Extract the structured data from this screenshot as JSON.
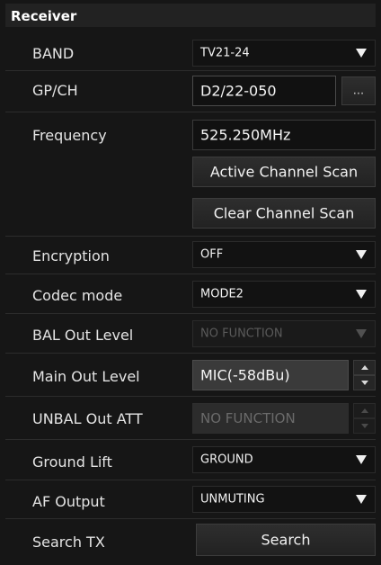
{
  "header": {
    "title": "Receiver"
  },
  "band": {
    "label": "BAND",
    "value": "TV21-24"
  },
  "gpch": {
    "label": "GP/CH",
    "value": "D2/22-050",
    "more_label": "..."
  },
  "frequency": {
    "label": "Frequency",
    "value": "525.250MHz"
  },
  "active_scan": {
    "label": "Active Channel Scan"
  },
  "clear_scan": {
    "label": "Clear Channel Scan"
  },
  "encryption": {
    "label": "Encryption",
    "value": "OFF"
  },
  "codec": {
    "label": "Codec mode",
    "value": "MODE2"
  },
  "bal_out": {
    "label": "BAL Out Level",
    "value": "NO FUNCTION"
  },
  "main_out": {
    "label": "Main Out Level",
    "value": "MIC(-58dBu)"
  },
  "unbal_att": {
    "label": "UNBAL Out ATT",
    "value": "NO FUNCTION"
  },
  "ground_lift": {
    "label": "Ground Lift",
    "value": "GROUND"
  },
  "af_output": {
    "label": "AF Output",
    "value": "UNMUTING"
  },
  "search_tx": {
    "label": "Search TX",
    "button_label": "Search"
  }
}
